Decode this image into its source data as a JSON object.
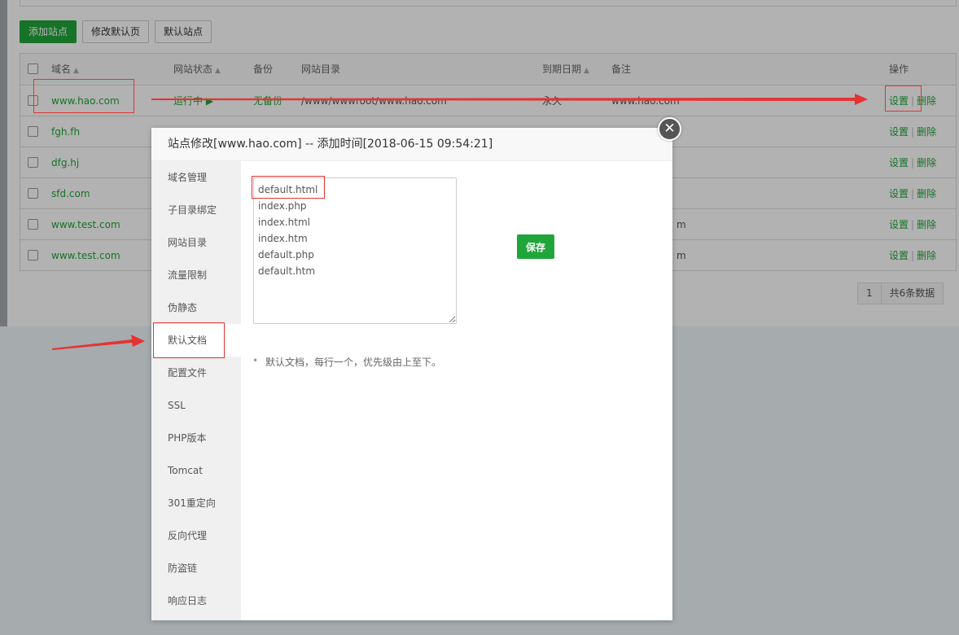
{
  "toolbar": {
    "add_site": "添加站点",
    "edit_default_page": "修改默认页",
    "default_site": "默认站点"
  },
  "table": {
    "headers": {
      "domain": "域名",
      "status": "网站状态",
      "backup": "备份",
      "path": "网站目录",
      "expire": "到期日期",
      "note": "备注",
      "ops": "操作"
    },
    "rows": [
      {
        "domain": "www.hao.com",
        "status": "运行中 ▶",
        "backup": "无备份",
        "path": "/www/wwwroot/www.hao.com",
        "expire": "永久",
        "note": "www.hao.com"
      },
      {
        "domain": "fgh.fh"
      },
      {
        "domain": "dfg.hj"
      },
      {
        "domain": "sfd.com"
      },
      {
        "domain": "www.test.com",
        "note_tail": "m"
      },
      {
        "domain": "www.test.com",
        "note_tail": "m"
      }
    ],
    "op_settings": "设置",
    "op_delete": "删除",
    "op_sep": "|"
  },
  "pager": {
    "current": "1",
    "total": "共6条数据"
  },
  "modal": {
    "title": "站点修改[www.hao.com] -- 添加时间[2018-06-15 09:54:21]",
    "close_glyph": "✕",
    "menu": [
      "域名管理",
      "子目录绑定",
      "网站目录",
      "流量限制",
      "伪静态",
      "默认文档",
      "配置文件",
      "SSL",
      "PHP版本",
      "Tomcat",
      "301重定向",
      "反向代理",
      "防盗链",
      "响应日志"
    ],
    "active_index": 5,
    "default_docs": "default.html\nindex.php\nindex.html\nindex.htm\ndefault.php\ndefault.htm",
    "save_label": "保存",
    "hint": "默认文档，每行一个，优先级由上至下。"
  },
  "colors": {
    "accent": "#20a53a",
    "annotation": "#e53333"
  }
}
